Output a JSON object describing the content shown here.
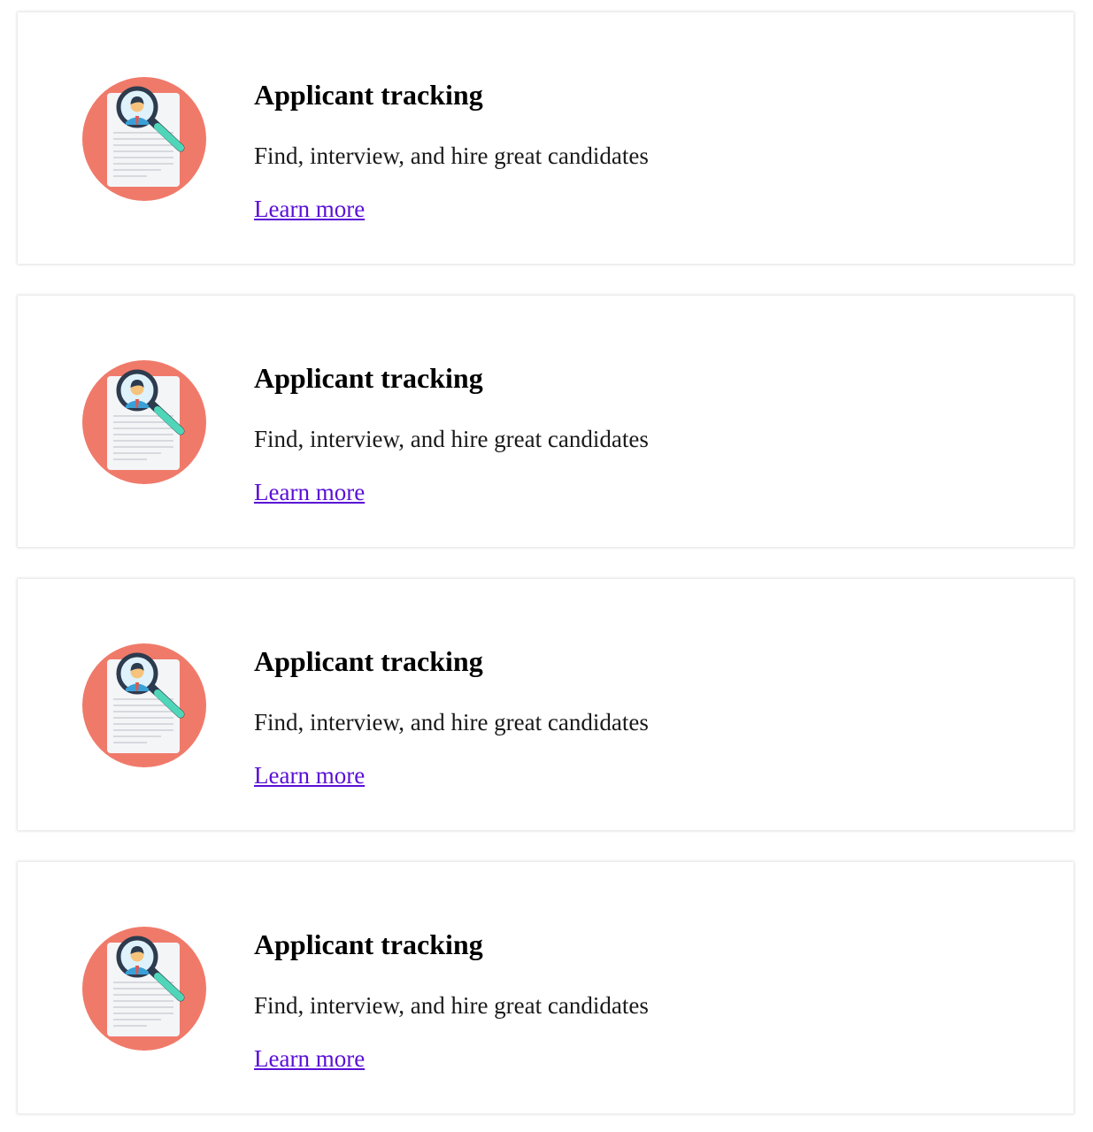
{
  "cards": [
    {
      "icon": "applicant-search-icon",
      "title": "Applicant tracking",
      "description": "Find, interview, and hire great candidates",
      "link_label": "Learn more"
    },
    {
      "icon": "applicant-search-icon",
      "title": "Applicant tracking",
      "description": "Find, interview, and hire great candidates",
      "link_label": "Learn more"
    },
    {
      "icon": "applicant-search-icon",
      "title": "Applicant tracking",
      "description": "Find, interview, and hire great candidates",
      "link_label": "Learn more"
    },
    {
      "icon": "applicant-search-icon",
      "title": "Applicant tracking",
      "description": "Find, interview, and hire great candidates",
      "link_label": "Learn more"
    }
  ],
  "colors": {
    "icon_circle": "#f07a6a",
    "icon_paper": "#f4f5f7",
    "icon_handle": "#4fd6b8",
    "icon_lens_rim": "#2d3b4e",
    "link": "#5a0fd6"
  }
}
